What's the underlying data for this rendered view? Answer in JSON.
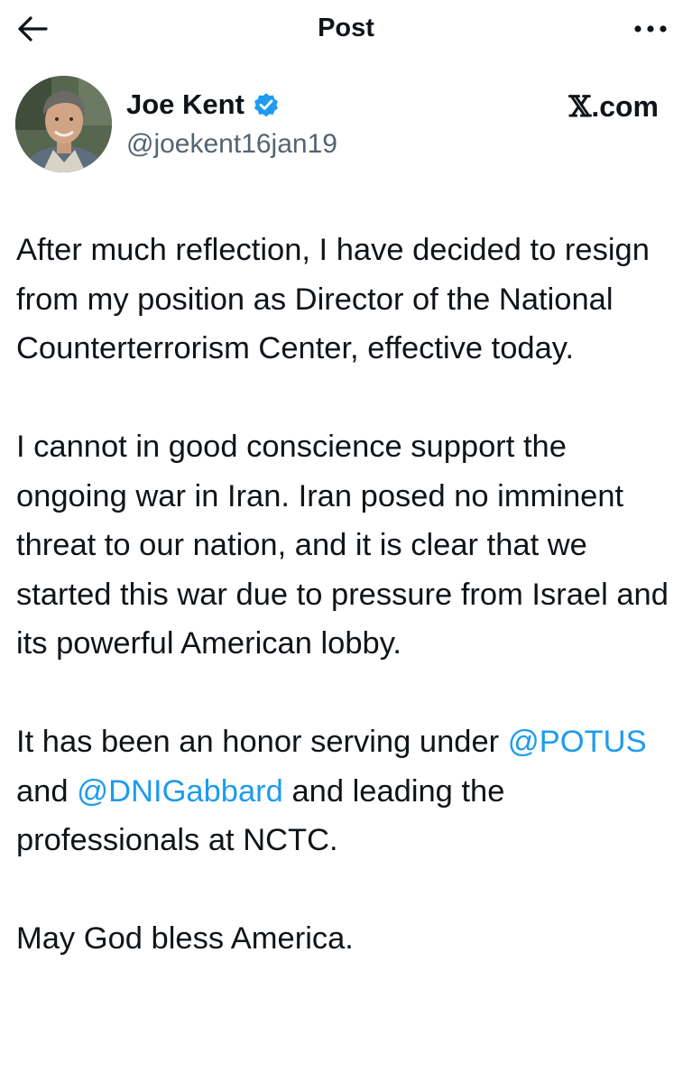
{
  "header": {
    "title": "Post",
    "back_icon": "arrow-left-icon",
    "more_icon": "more-horizontal-icon"
  },
  "author": {
    "name": "Joe Kent",
    "handle": "@joekent16jan19",
    "verified_icon": "verified-badge-icon",
    "verified_color": "#1d9bf0"
  },
  "brand": {
    "mark": "𝕏",
    "suffix": ".com"
  },
  "tweet": {
    "paragraph_1": "After much reflection, I have decided to resign from my position as Director of the National Counterterrorism Center, effective today.",
    "paragraph_2": "I cannot in good conscience support the ongoing war in Iran. Iran posed no imminent threat to our nation, and it is clear that we started this war due to pressure from Israel and its powerful American lobby.",
    "paragraph_3": {
      "text_before": "It has been an honor serving under ",
      "mention_1": "@POTUS",
      "text_middle": " and ",
      "mention_2": "@DNIGabbard",
      "text_after": " and leading the professionals at NCTC."
    },
    "paragraph_4": "May God bless America.",
    "mention_color": "#1d9bf0"
  }
}
